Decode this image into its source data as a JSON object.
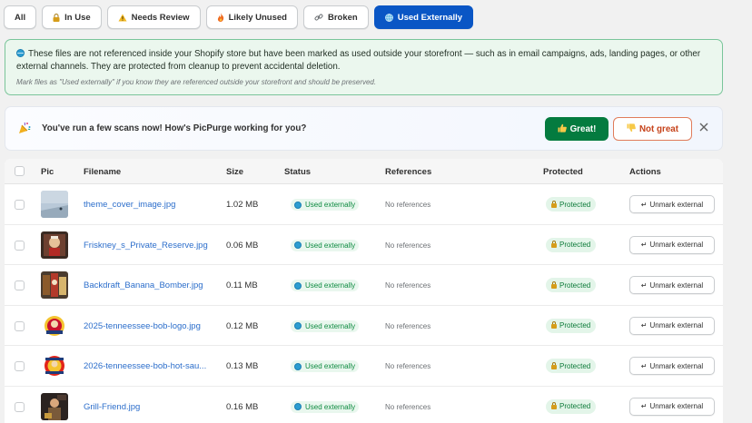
{
  "filters": [
    {
      "label": "All",
      "icon": "",
      "active": false
    },
    {
      "label": "In Use",
      "icon": "lock-icon",
      "active": false
    },
    {
      "label": "Needs Review",
      "icon": "warning-icon",
      "active": false
    },
    {
      "label": "Likely Unused",
      "icon": "fire-icon",
      "active": false
    },
    {
      "label": "Broken",
      "icon": "link-icon",
      "active": false
    },
    {
      "label": "Used Externally",
      "icon": "globe-icon",
      "active": true
    }
  ],
  "info": {
    "line1": "These files are not referenced inside your Shopify store but have been marked as used outside your storefront — such as in email campaigns, ads, landing pages, or other",
    "line2": "external channels. They are protected from cleanup to prevent accidental deletion.",
    "note": "Mark files as \"Used externally\" if you know they are referenced outside your storefront and should be preserved."
  },
  "feedback": {
    "question": "You've run a few scans now! How's PicPurge working for you?",
    "great_label": "Great!",
    "not_great_label": "Not great"
  },
  "table": {
    "headers": {
      "pic": "Pic",
      "filename": "Filename",
      "size": "Size",
      "status": "Status",
      "references": "References",
      "protected": "Protected",
      "actions": "Actions"
    },
    "rows": [
      {
        "filename": "theme_cover_image.jpg",
        "size": "1.02 MB",
        "status": "Used externally",
        "references": "No references",
        "protected": "Protected",
        "action": "Unmark external"
      },
      {
        "filename": "Friskney_s_Private_Reserve.jpg",
        "size": "0.06 MB",
        "status": "Used externally",
        "references": "No references",
        "protected": "Protected",
        "action": "Unmark external"
      },
      {
        "filename": "Backdraft_Banana_Bomber.jpg",
        "size": "0.11 MB",
        "status": "Used externally",
        "references": "No references",
        "protected": "Protected",
        "action": "Unmark external"
      },
      {
        "filename": "2025-tenneessee-bob-logo.jpg",
        "size": "0.12 MB",
        "status": "Used externally",
        "references": "No references",
        "protected": "Protected",
        "action": "Unmark external"
      },
      {
        "filename": "2026-tenneessee-bob-hot-sau...",
        "size": "0.13 MB",
        "status": "Used externally",
        "references": "No references",
        "protected": "Protected",
        "action": "Unmark external"
      },
      {
        "filename": "Grill-Friend.jpg",
        "size": "0.16 MB",
        "status": "Used externally",
        "references": "No references",
        "protected": "Protected",
        "action": "Unmark external"
      }
    ]
  },
  "colors": {
    "accent": "#0a56c5",
    "success": "#047b3f",
    "link": "#2c6ecb"
  }
}
